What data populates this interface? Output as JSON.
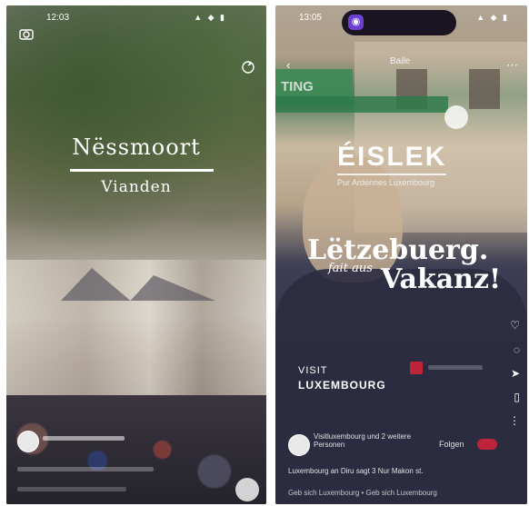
{
  "left_screen": {
    "status_time": "12:03",
    "status_icons": "▲ ◆ ▮",
    "title": "Nëssmoort",
    "subtitle": "Vianden",
    "icon_camera": "camera-icon",
    "icon_refresh": "refresh-icon"
  },
  "right_screen": {
    "status_time": "13:05",
    "status_icons": "▲ ◆ ▮",
    "island_icon": "◉",
    "top_label": "Baile",
    "sign_text": "TING",
    "brand": "ÉISLEK",
    "brand_sub": "Pur Ardennes Luxembourg",
    "headline_1": "Lëtzebuerg.",
    "headline_2a": "fait aus",
    "headline_2b": "Vakanz!",
    "visit_1": "VISIT",
    "visit_2": "LUXEMBOURG",
    "account_name": "Visitluxembourg und 2 weitere Personen",
    "follow_label": "Folgen",
    "caption": "Luxembourg an Diru sagt 3 Nur Makon st.",
    "music": "Geb sich Luxembourg • Geb sich Luxembourg"
  },
  "colors": {
    "accent_red": "#c0243a",
    "sign_green": "#3e8a55",
    "island_purple": "#6b3fd0"
  }
}
